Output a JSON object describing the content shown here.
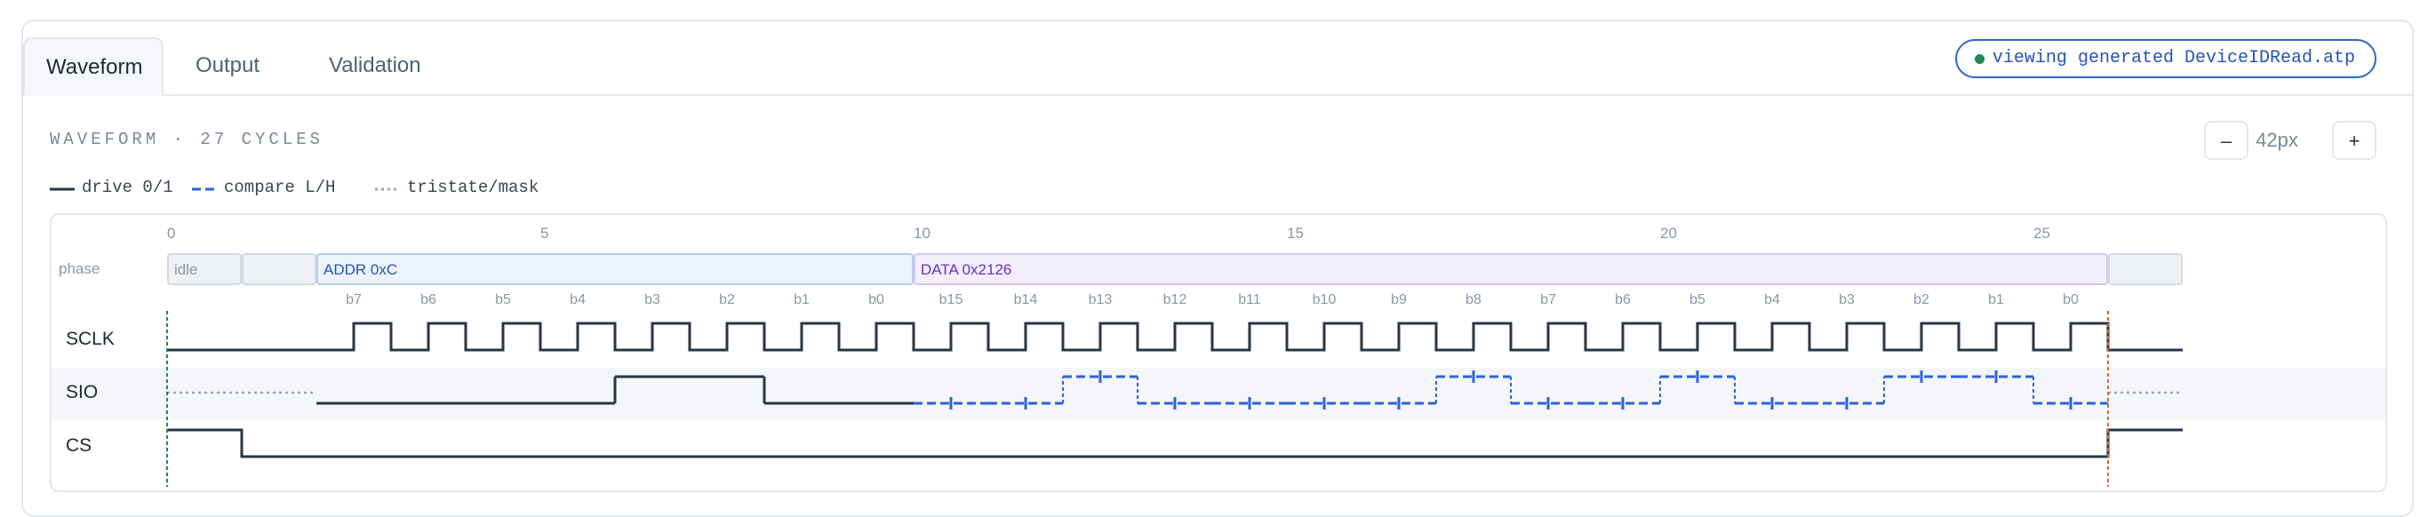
{
  "tabs": [
    {
      "label": "Waveform",
      "active": true
    },
    {
      "label": "Output",
      "active": false
    },
    {
      "label": "Validation",
      "active": false
    }
  ],
  "status_pill": {
    "text": "viewing generated DeviceIDRead.atp",
    "dot_color": "#1c8a5a"
  },
  "waveform": {
    "title": "WAVEFORM · 27 CYCLES",
    "zoom": {
      "minus_label": "–",
      "value": "42px",
      "plus_label": "+"
    },
    "legend": [
      {
        "style": "drive",
        "label": "drive 0/1"
      },
      {
        "style": "compare",
        "label": "compare L/H"
      },
      {
        "style": "tristate",
        "label": "tristate/mask"
      }
    ],
    "cycles": 27,
    "cycle_ticks": [
      {
        "cycle": 0,
        "label": "0"
      },
      {
        "cycle": 5,
        "label": "5"
      },
      {
        "cycle": 10,
        "label": "10"
      },
      {
        "cycle": 15,
        "label": "15"
      },
      {
        "cycle": 20,
        "label": "20"
      },
      {
        "cycle": 25,
        "label": "25"
      }
    ],
    "phase_label": "phase",
    "phases": [
      {
        "start": 0,
        "end": 1,
        "label": "idle",
        "kind": "idle"
      },
      {
        "start": 1,
        "end": 2,
        "label": "",
        "kind": "idle"
      },
      {
        "start": 2,
        "end": 10,
        "label": "ADDR 0xC",
        "kind": "addr"
      },
      {
        "start": 10,
        "end": 26,
        "label": "DATA 0x2126",
        "kind": "data"
      },
      {
        "start": 26,
        "end": 27,
        "label": "",
        "kind": "idle"
      }
    ],
    "bit_labels": [
      "b7",
      "b6",
      "b5",
      "b4",
      "b3",
      "b2",
      "b1",
      "b0",
      "b15",
      "b14",
      "b13",
      "b12",
      "b11",
      "b10",
      "b9",
      "b8",
      "b7",
      "b6",
      "b5",
      "b4",
      "b3",
      "b2",
      "b1",
      "b0"
    ],
    "bit_label_start_cycle": 2,
    "signals": [
      {
        "name": "SCLK",
        "mode": "clock",
        "clock_cycles": [
          2,
          25
        ]
      },
      {
        "name": "SIO",
        "mode": "mixed",
        "segments": [
          {
            "from": 0,
            "to": 2,
            "type": "tristate"
          },
          {
            "from": 2,
            "to": 6,
            "type": "drive",
            "value": 0
          },
          {
            "from": 6,
            "to": 8,
            "type": "drive",
            "value": 1
          },
          {
            "from": 8,
            "to": 10,
            "type": "drive",
            "value": 0
          },
          {
            "from": 10,
            "to": 26,
            "type": "compare",
            "bits": [
              0,
              0,
              1,
              0,
              0,
              0,
              0,
              1,
              0,
              0,
              1,
              0,
              0,
              1,
              1,
              0
            ]
          },
          {
            "from": 26,
            "to": 27,
            "type": "tristate"
          }
        ]
      },
      {
        "name": "CS",
        "mode": "drive",
        "levels": [
          1,
          0,
          0,
          0,
          0,
          0,
          0,
          0,
          0,
          0,
          0,
          0,
          0,
          0,
          0,
          0,
          0,
          0,
          0,
          0,
          0,
          0,
          0,
          0,
          0,
          0,
          1
        ]
      }
    ],
    "markers": [
      {
        "cycle": 0,
        "color": "#1c8a5a"
      },
      {
        "cycle": 26,
        "color": "#d9662b"
      }
    ],
    "colors": {
      "drive": "#2a3545",
      "compare": "#2d63d8",
      "tristate": "#9aa5b3",
      "addr_fill": "#edf3fd",
      "addr_border": "#b7cbef",
      "addr_text": "#2554b0",
      "data_fill": "#f3eefc",
      "data_border": "#d4c5f0",
      "data_text": "#6b31b5",
      "idle_fill": "#eef1f5",
      "idle_border": "#d3d9e2"
    }
  }
}
